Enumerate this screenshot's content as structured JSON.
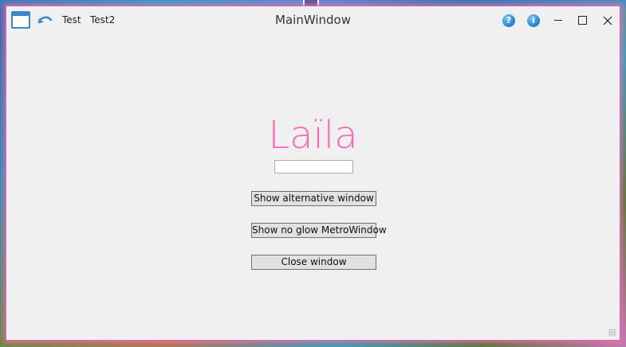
{
  "window": {
    "title": "MainWindow",
    "accent_color": "#ff66b3",
    "glow_color": "#ff69b4"
  },
  "titlebar": {
    "app_icon": "window-app-icon",
    "command_icon": "undo-arrow-icon",
    "commands": [
      {
        "label": "Test"
      },
      {
        "label": "Test2"
      }
    ],
    "right_icons": [
      "help-icon",
      "info-icon"
    ],
    "system_buttons": [
      "minimize-icon",
      "maximize-icon",
      "close-icon"
    ]
  },
  "content": {
    "heading": "Laïla",
    "name_input": {
      "value": "",
      "placeholder": ""
    },
    "buttons": [
      {
        "label": "Show alternative window"
      },
      {
        "label": "Show no glow MetroWindow"
      },
      {
        "label": "Close window"
      }
    ]
  }
}
